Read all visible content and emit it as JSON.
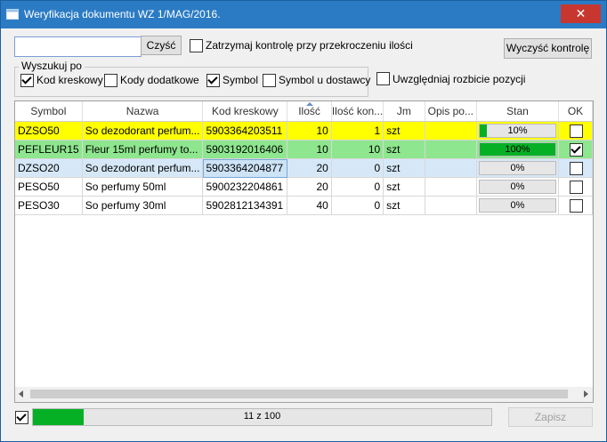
{
  "window": {
    "title": "Weryfikacja dokumentu WZ 1/MAG/2016.",
    "close_glyph": "✕"
  },
  "toolbar": {
    "search_value": "",
    "clear_label": "Czyść",
    "stop_label": "Zatrzymaj kontrolę przy przekroczeniu ilości",
    "stop_checked": false,
    "reset_label": "Wyczyść kontrolę"
  },
  "search_group": {
    "legend": "Wyszukuj po",
    "options": [
      {
        "label": "Kod kreskowy",
        "checked": true
      },
      {
        "label": "Kody dodatkowe",
        "checked": false
      },
      {
        "label": "Symbol",
        "checked": true
      },
      {
        "label": "Symbol u dostawcy",
        "checked": false
      }
    ]
  },
  "split_label": "Uwzględniaj rozbicie pozycji",
  "split_checked": false,
  "table": {
    "columns": [
      "Symbol",
      "Nazwa",
      "Kod kreskowy",
      "Ilość",
      "Ilość kon...",
      "Jm",
      "Opis po...",
      "Stan",
      "OK"
    ],
    "rows": [
      {
        "symbol": "DZSO50",
        "name": "So dezodorant perfum...",
        "barcode": "5903364203511",
        "qty": "10",
        "checked_qty": "1",
        "unit": "szt",
        "desc": "",
        "state": "10%",
        "progress": 0.1,
        "ok": false,
        "style": "yellow"
      },
      {
        "symbol": "PEFLEUR15",
        "name": "Fleur 15ml perfumy to...",
        "barcode": "5903192016406",
        "qty": "10",
        "checked_qty": "10",
        "unit": "szt",
        "desc": "",
        "state": "100%",
        "progress": 1.0,
        "ok": true,
        "style": "green"
      },
      {
        "symbol": "DZSO20",
        "name": "So dezodorant perfum...",
        "barcode": "5903364204877",
        "qty": "20",
        "checked_qty": "0",
        "unit": "szt",
        "desc": "",
        "state": "0%",
        "progress": 0,
        "ok": false,
        "style": "sel"
      },
      {
        "symbol": "PESO50",
        "name": "So perfumy 50ml",
        "barcode": "5900232204861",
        "qty": "20",
        "checked_qty": "0",
        "unit": "szt",
        "desc": "",
        "state": "0%",
        "progress": 0,
        "ok": false,
        "style": ""
      },
      {
        "symbol": "PESO30",
        "name": "So perfumy 30ml",
        "barcode": "5902812134391",
        "qty": "40",
        "checked_qty": "0",
        "unit": "szt",
        "desc": "",
        "state": "0%",
        "progress": 0,
        "ok": false,
        "style": ""
      }
    ]
  },
  "footer": {
    "all_checked": true,
    "progress_text": "11 z 100",
    "progress": 0.11,
    "save_label": "Zapisz"
  },
  "colors": {
    "titlebar": "#2b7bc4",
    "close": "#c7372f",
    "progress": "#06b025",
    "row_ok": "#8ee68e",
    "row_partial": "#ffff00",
    "row_selected": "#d6e8f8"
  }
}
